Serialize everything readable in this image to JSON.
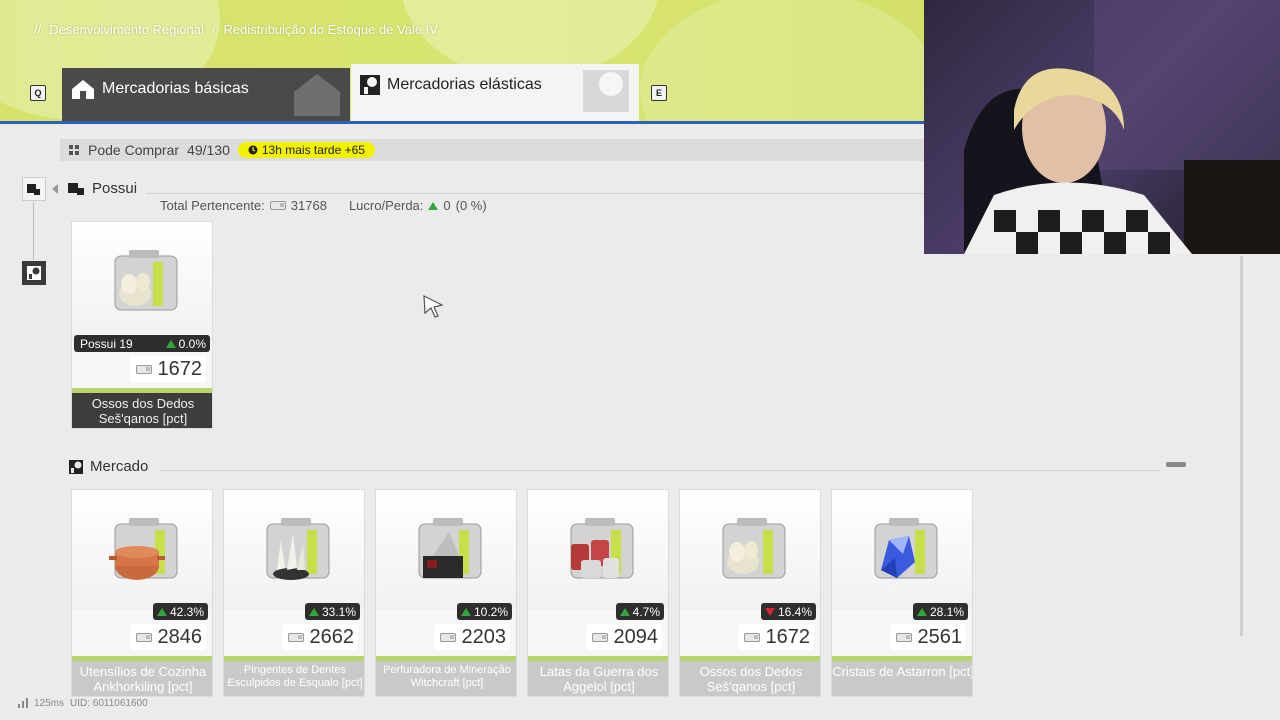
{
  "breadcrumb": {
    "prefix": "//",
    "items": [
      "Desenvolvimento Regional",
      "Redistribuição do Estoque de Vale IV"
    ],
    "separator": "/"
  },
  "tabs": {
    "left_key": "Q",
    "right_key": "E",
    "basic_label": "Mercadorias básicas",
    "elastic_label": "Mercadorias elásticas"
  },
  "buy_bar": {
    "label": "Pode Comprar",
    "count": "49/130",
    "timer": "13h mais tarde +65"
  },
  "owned": {
    "title": "Possui",
    "total_label": "Total Pertencente:",
    "total_value": "31768",
    "profit_label": "Lucro/Perda:",
    "profit_value": "0",
    "profit_pct": "(0 %)",
    "card": {
      "owned_label": "Possui 19",
      "change": "0.0%",
      "price": "1672",
      "name": "Ossos dos Dedos Seš'qanos [pct]"
    }
  },
  "market": {
    "title": "Mercado",
    "items": [
      {
        "change": "42.3%",
        "direction": "up",
        "price": "2846",
        "name": "Utensílios de Cozinha Ankhorkiling [pct]",
        "icon": "cooking-pot-icon"
      },
      {
        "change": "33.1%",
        "direction": "up",
        "price": "2662",
        "name": "Pingentes de Dentes Esculpidos de Esqualo [pct]",
        "icon": "tooth-pendant-icon"
      },
      {
        "change": "10.2%",
        "direction": "up",
        "price": "2203",
        "name": "Perfuradora de Mineração Witchcraft [pct]",
        "icon": "mining-drill-icon"
      },
      {
        "change": "4.7%",
        "direction": "up",
        "price": "2094",
        "name": "Latas da Guerra dos Aggelol [pct]",
        "icon": "cans-icon"
      },
      {
        "change": "16.4%",
        "direction": "down",
        "price": "1672",
        "name": "Ossos dos Dedos Seš'qanos [pct]",
        "icon": "finger-bones-icon"
      },
      {
        "change": "28.1%",
        "direction": "up",
        "price": "2561",
        "name": "Cristais de Astarron [pct]",
        "icon": "crystal-icon"
      }
    ]
  },
  "footer": {
    "ping": "125ms",
    "uid": "UID: 6011061600"
  },
  "colors": {
    "accent_green": "#2faa3a",
    "accent_red": "#d8242e",
    "header_lime": "#d6e26a",
    "tab_blue_line": "#2d62b8",
    "timer_yellow": "#f2f200"
  }
}
